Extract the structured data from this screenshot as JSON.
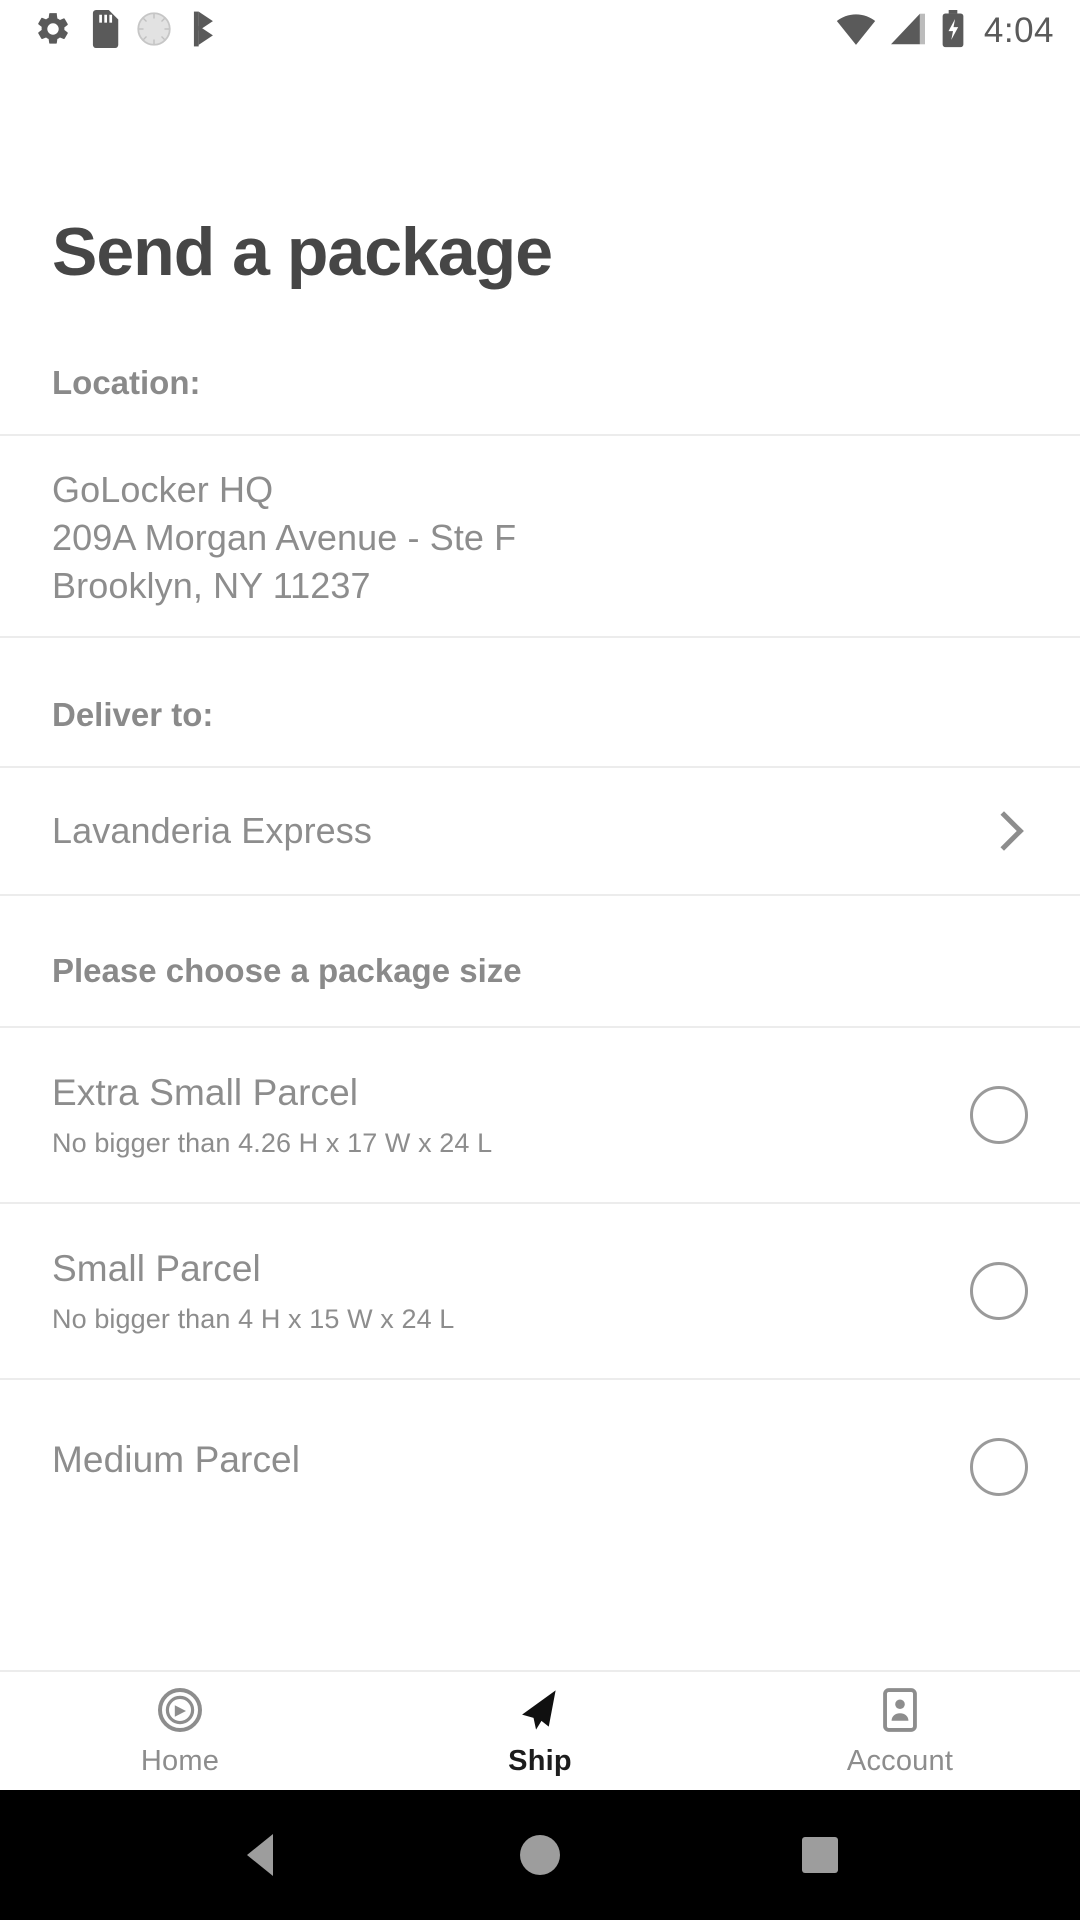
{
  "status_bar": {
    "icons_left": [
      "settings-gear-icon",
      "sd-card-icon",
      "sync-disc-icon",
      "checkmark-flag-icon"
    ],
    "icons_right": [
      "wifi-icon",
      "cellular-signal-icon",
      "battery-charging-icon"
    ],
    "time": "4:04"
  },
  "page": {
    "title": "Send a package"
  },
  "sections": {
    "location_label": "Location:",
    "deliver_label": "Deliver to:",
    "choose_label": "Please choose a package size"
  },
  "location": {
    "name": "GoLocker HQ",
    "street": "209A Morgan Avenue - Ste F",
    "city_state_zip": "Brooklyn, NY 11237"
  },
  "deliver_to": {
    "value": "Lavanderia Express",
    "chevron": "chevron-right-icon"
  },
  "package_sizes": [
    {
      "name": "Extra Small Parcel",
      "description": "No bigger than 4.26 H x 17 W x 24 L",
      "selected": false
    },
    {
      "name": "Small Parcel",
      "description": "No bigger than 4 H x 15 W x 24 L",
      "selected": false
    },
    {
      "name": "Medium Parcel",
      "description": "",
      "selected": false
    }
  ],
  "tabbar": {
    "items": [
      {
        "label": "Home",
        "icon": "compass-icon",
        "active": false
      },
      {
        "label": "Ship",
        "icon": "paper-plane-icon",
        "active": true
      },
      {
        "label": "Account",
        "icon": "contact-card-icon",
        "active": false
      }
    ]
  },
  "android_nav": {
    "back": "back-triangle-icon",
    "home": "home-circle-icon",
    "recents": "recents-square-icon"
  },
  "colors": {
    "title": "#464646",
    "section_label": "#8a8a8a",
    "body_text": "#8d8d8d",
    "divider": "#ececec",
    "active_tab": "#1d1d1d",
    "nav_bar_bg": "#000000"
  }
}
